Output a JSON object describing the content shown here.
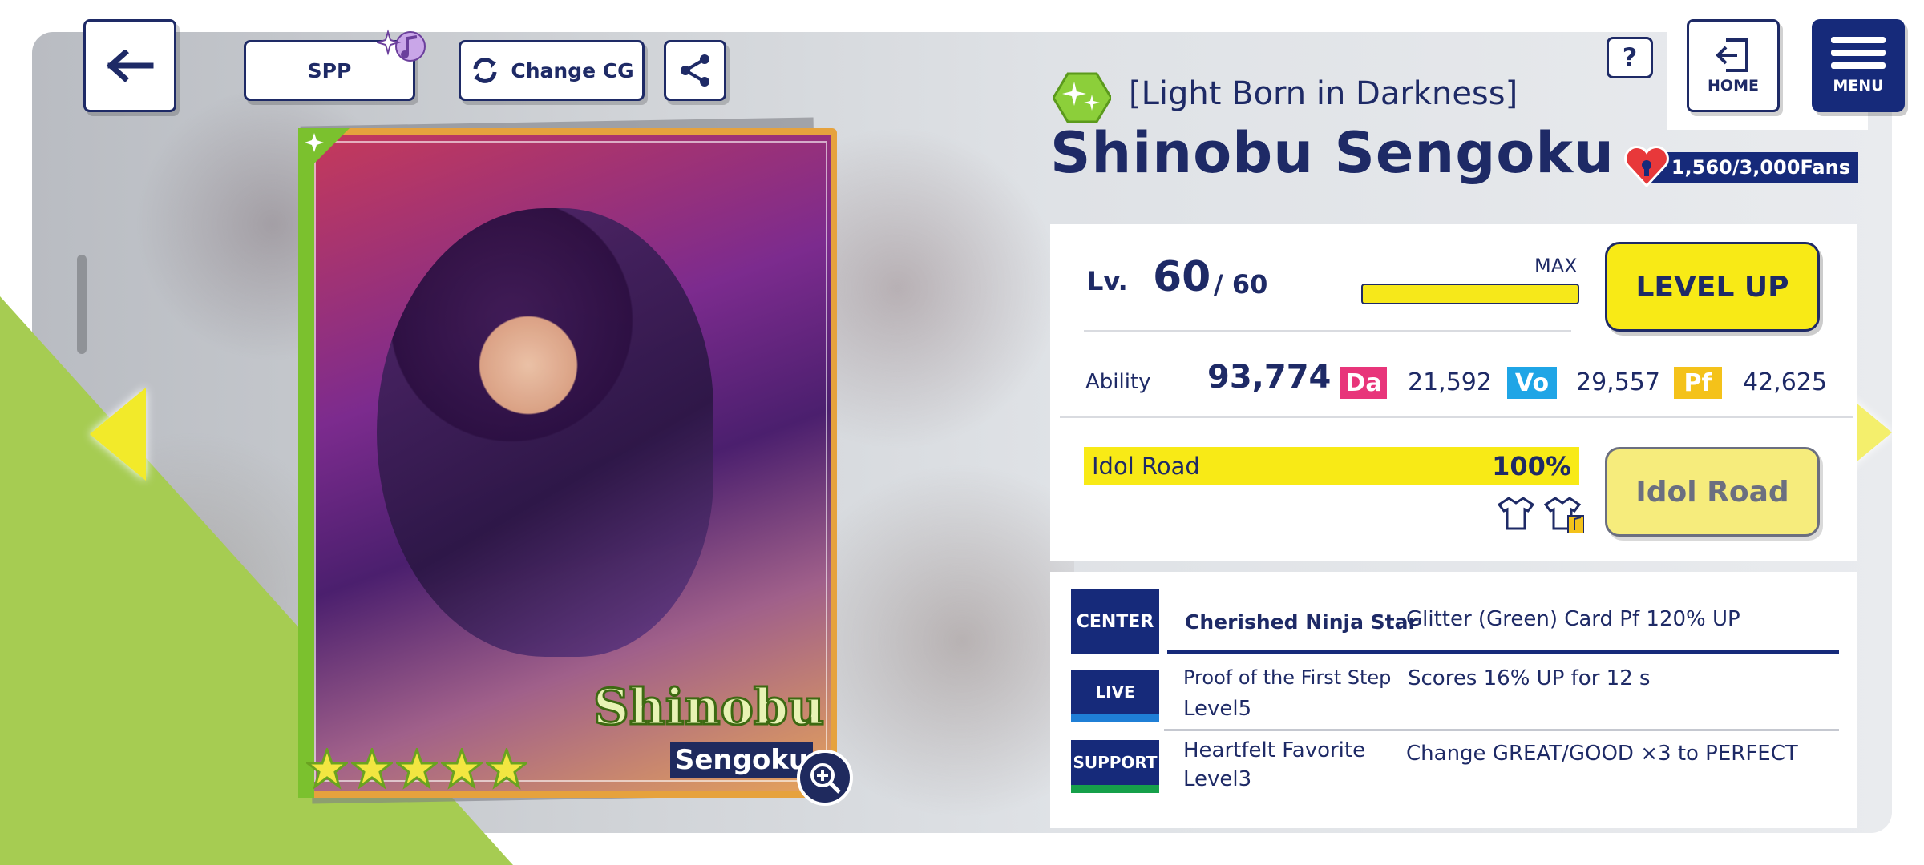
{
  "top_bar": {
    "spp_label": "SPP",
    "change_cg_label": "Change CG",
    "help_label": "?",
    "home_label": "HOME",
    "menu_label": "MENU"
  },
  "card_art": {
    "name_line1": "Shinobu",
    "name_line2": "Sengoku",
    "star_count": 5
  },
  "card_info": {
    "title": "[Light Born in Darkness]",
    "character_name": "Shinobu Sengoku",
    "fans": "1,560/3,000Fans",
    "attribute_color": "#8ccf3a"
  },
  "level": {
    "label": "Lv.",
    "current": "60",
    "max": "/ 60",
    "max_tag": "MAX",
    "progress": 1.0,
    "level_up_label": "LEVEL UP"
  },
  "ability": {
    "label": "Ability",
    "total": "93,774",
    "da_tag": "Da",
    "da_value": "21,592",
    "vo_tag": "Vo",
    "vo_value": "29,557",
    "pf_tag": "Pf",
    "pf_value": "42,625"
  },
  "idol_road": {
    "label": "Idol Road",
    "percent": "100%",
    "button_label": "Idol Road"
  },
  "skills": {
    "center": {
      "tag": "CENTER",
      "name": "Cherished Ninja Star",
      "desc": "Glitter (Green) Card Pf 120% UP"
    },
    "live": {
      "tag": "LIVE",
      "name": "Proof of the First Step",
      "level": "Level5",
      "desc": "Scores 16% UP for 12 s"
    },
    "support": {
      "tag": "SUPPORT",
      "name": "Heartfelt Favorite",
      "level": "Level3",
      "desc": "Change GREAT/GOOD ×3 to PERFECT"
    }
  },
  "colors": {
    "navy": "#1e2a66",
    "yellow": "#f8ea16",
    "da": "#e8357a",
    "vo": "#1fa5e6",
    "pf": "#f4c21a"
  }
}
